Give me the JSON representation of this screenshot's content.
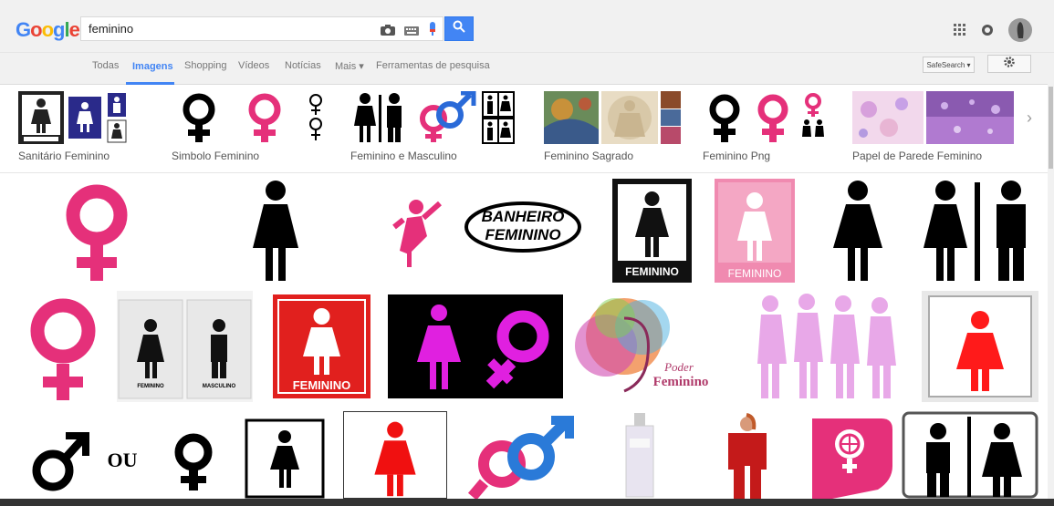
{
  "header": {
    "logo": "Google",
    "search_value": "feminino",
    "icons": [
      "camera-icon",
      "keyboard-icon",
      "mic-icon",
      "search-icon",
      "apps-icon",
      "notifications-icon",
      "avatar"
    ]
  },
  "tabs": {
    "items": [
      "Todas",
      "Imagens",
      "Shopping",
      "Vídeos",
      "Notícias",
      "Mais ▾",
      "Ferramentas de pesquisa"
    ],
    "active": "Imagens",
    "safe_search": "SafeSearch ▾"
  },
  "related": {
    "items": [
      {
        "label": "Sanitário Feminino"
      },
      {
        "label": "Simbolo Feminino"
      },
      {
        "label": "Feminino e Masculino"
      },
      {
        "label": "Feminino Sagrado"
      },
      {
        "label": "Feminino Png"
      },
      {
        "label": "Papel de Parede Feminino"
      }
    ]
  },
  "results": {
    "sign_labels": [
      "BANHEIRO FEMININO",
      "FEMININO",
      "FEMININO",
      "MASCULINO",
      "FEMININO",
      "Poder Feminino",
      "OU"
    ]
  },
  "colors": {
    "pink": "#e5307a",
    "magenta": "#e020e0",
    "red": "#e1201e",
    "blue": "#4285f4",
    "black": "#000000"
  }
}
